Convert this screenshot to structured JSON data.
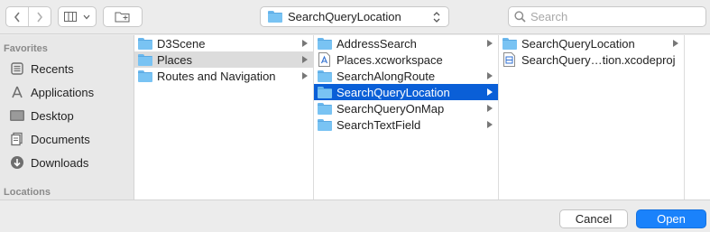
{
  "toolbar": {
    "back_icon": "chevron-left-icon",
    "forward_icon": "chevron-right-icon",
    "view_icon": "column-view-icon",
    "new_folder_icon": "new-folder-icon",
    "path_popup_label": "SearchQueryLocation",
    "search_placeholder": "Search",
    "search_value": ""
  },
  "sidebar": {
    "favorites_heading": "Favorites",
    "locations_heading": "Locations",
    "items": [
      {
        "label": "Recents",
        "icon": "recents-icon"
      },
      {
        "label": "Applications",
        "icon": "applications-icon"
      },
      {
        "label": "Desktop",
        "icon": "desktop-icon"
      },
      {
        "label": "Documents",
        "icon": "documents-icon"
      },
      {
        "label": "Downloads",
        "icon": "downloads-icon"
      }
    ]
  },
  "columns": [
    {
      "items": [
        {
          "name": "D3Scene",
          "type": "folder",
          "has_children": true
        },
        {
          "name": "Places",
          "type": "folder",
          "has_children": true,
          "selected": "gray"
        },
        {
          "name": "Routes and Navigation",
          "type": "folder",
          "has_children": true
        }
      ]
    },
    {
      "items": [
        {
          "name": "AddressSearch",
          "type": "folder",
          "has_children": true
        },
        {
          "name": "Places.xcworkspace",
          "type": "workspace",
          "has_children": false
        },
        {
          "name": "SearchAlongRoute",
          "type": "folder",
          "has_children": true
        },
        {
          "name": "SearchQueryLocation",
          "type": "folder",
          "has_children": true,
          "selected": "blue"
        },
        {
          "name": "SearchQueryOnMap",
          "type": "folder",
          "has_children": true
        },
        {
          "name": "SearchTextField",
          "type": "folder",
          "has_children": true
        }
      ]
    },
    {
      "items": [
        {
          "name": "SearchQueryLocation",
          "type": "folder",
          "has_children": true
        },
        {
          "name": "SearchQuery…tion.xcodeproj",
          "type": "xcodeproj",
          "has_children": false
        }
      ]
    }
  ],
  "footer": {
    "cancel_label": "Cancel",
    "open_label": "Open"
  },
  "colors": {
    "selection_blue": "#0a5fd7",
    "open_button": "#1a82fb",
    "folder": "#79c3f3"
  }
}
